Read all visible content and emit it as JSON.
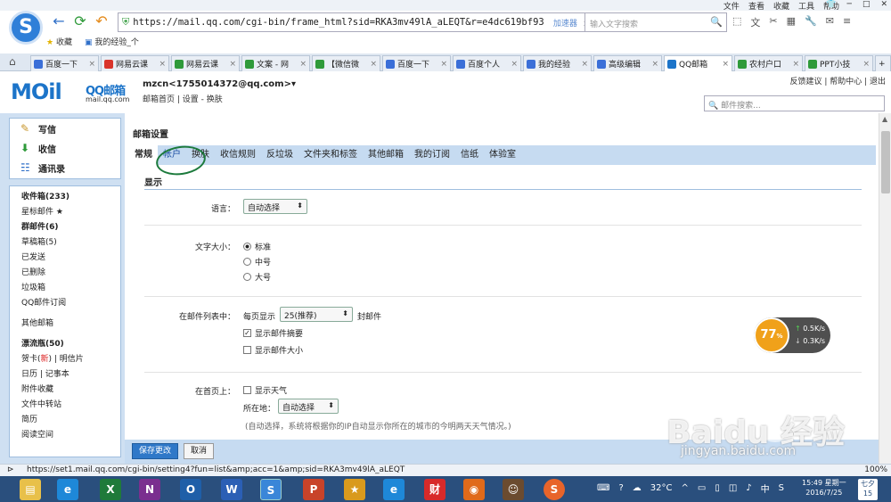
{
  "browser": {
    "menu": [
      "文件",
      "查看",
      "收藏",
      "工具",
      "帮助"
    ],
    "url": "https://mail.qq.com/cgi-bin/frame_html?sid=RKA3mv49lA_aLEQT&r=e4dc619bf93",
    "accelerator": "加速器",
    "search_placeholder": "输入文字搜索",
    "favorites": [
      "收藏",
      "我的经验_个"
    ],
    "tabs": [
      {
        "label": "百度一下",
        "color": "#3b6fd8"
      },
      {
        "label": "网易云课",
        "color": "#d9342b"
      },
      {
        "label": "网易云课",
        "color": "#2f9a3a"
      },
      {
        "label": "文案 - 网",
        "color": "#2f9a3a"
      },
      {
        "label": "【微信微",
        "color": "#2f9a3a"
      },
      {
        "label": "百度一下",
        "color": "#3b6fd8"
      },
      {
        "label": "百度个人",
        "color": "#3b6fd8"
      },
      {
        "label": "我的经验",
        "color": "#3b6fd8"
      },
      {
        "label": "高级编辑",
        "color": "#3b6fd8"
      },
      {
        "label": "QQ邮箱",
        "color": "#1c74c9"
      },
      {
        "label": "农村户口",
        "color": "#2f9a3a"
      },
      {
        "label": "PPT小技",
        "color": "#2f9a3a"
      }
    ],
    "active_tab_index": 9,
    "status_url": "https://set1.mail.qq.com/cgi-bin/setting4?fun=list&amp;acc=1&amp;sid=RKA3mv49lA_aLEQT",
    "zoom": "100%"
  },
  "mail": {
    "logo_big": "MOil",
    "logo_name": "QQ邮箱",
    "logo_domain": "mail.qq.com",
    "user": "mzcn<1755014372@qq.com>▾",
    "user_links": "邮箱首页 | 设置 - 换肤",
    "top_links": "反馈建议 | 帮助中心 | 退出",
    "search_placeholder": "邮件搜索...",
    "compose": [
      {
        "label": "写信",
        "icon": "✎"
      },
      {
        "label": "收信",
        "icon": "⬇"
      },
      {
        "label": "通讯录",
        "icon": "☷"
      }
    ],
    "folders": {
      "inbox": "收件箱(233)",
      "starred": "星标邮件 ★",
      "group": "群邮件(6)",
      "drafts": "草稿箱(5)",
      "sent": "已发送",
      "deleted": "已删除",
      "spam": "垃圾箱",
      "subscribe": "QQ邮件订阅",
      "other": "其他邮箱",
      "bottle": "漂流瓶(50)",
      "card_pre": "贺卡(",
      "card_new": "新",
      "card_post": ") | 明信片",
      "calendar": "日历 | 记事本",
      "attachments": "附件收藏",
      "transfer": "文件中转站",
      "resume": "简历",
      "reading": "阅读空间"
    }
  },
  "settings": {
    "title": "邮箱设置",
    "tabs": [
      "常规",
      "帐户",
      "换肤",
      "收信规则",
      "反垃圾",
      "文件夹和标签",
      "其他邮箱",
      "我的订阅",
      "信纸",
      "体验室"
    ],
    "section_title": "显示",
    "language_label": "语言：",
    "language_value": "自动选择",
    "fontsize_label": "文字大小：",
    "fontsize_options": [
      "标准",
      "中号",
      "大号"
    ],
    "list_label": "在邮件列表中：",
    "per_page_prefix": "每页显示",
    "per_page_value": "25(推荐)",
    "per_page_suffix": "封邮件",
    "show_summary": "显示邮件摘要",
    "show_size": "显示邮件大小",
    "home_label": "在首页上：",
    "show_weather": "显示天气",
    "location_label": "所在地：",
    "location_value": "自动选择",
    "hint": "(自动选择，系统将根据你的IP自动显示你所在的城市的今明两天天气情况。)",
    "save_label": "保存更改",
    "cancel_label": "取消"
  },
  "speed_widget": {
    "percent": "77",
    "unit": "%",
    "up": "0.5",
    "down": "0.3",
    "rate_unit": "K/s"
  },
  "taskbar": {
    "temp": "32°C",
    "time": "15:49 星期一",
    "date": "2016/7/25",
    "badge_day": "七夕",
    "badge_num": "15"
  },
  "watermark": {
    "main": "Baidu 经验",
    "url": "jingyan.baidu.com"
  }
}
